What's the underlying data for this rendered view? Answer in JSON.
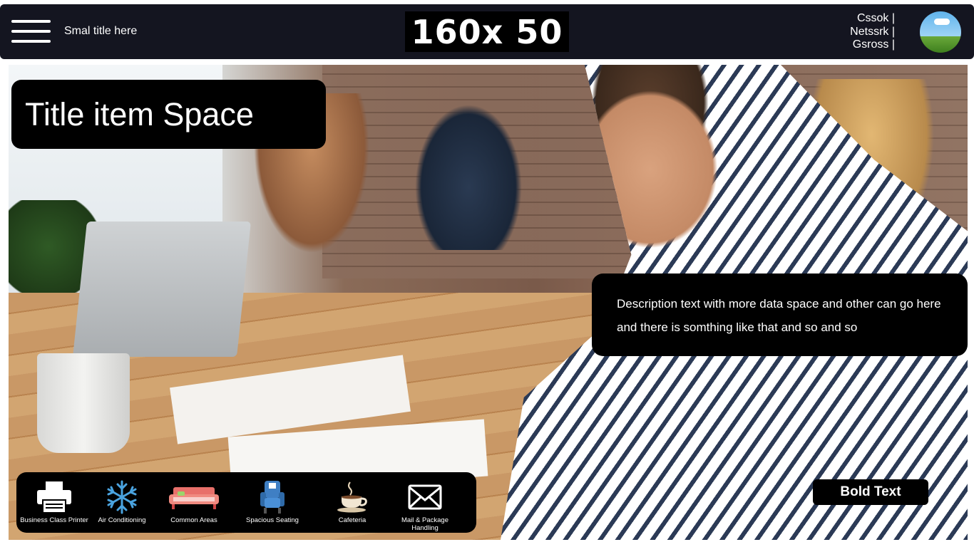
{
  "header": {
    "small_title": "Smal title  here",
    "logo_text": "160x 50",
    "user_links": [
      "Cssok |",
      "Netssrk |",
      "Gsross |"
    ]
  },
  "hero": {
    "title": "Title item Space",
    "description": "Description text with more data space and other can go here and there is somthing like that and so and so",
    "bold_button": "Bold Text"
  },
  "amenities": [
    {
      "label": "Business Class Printer",
      "icon": "printer-icon"
    },
    {
      "label": "Air Conditioning",
      "icon": "snowflake-icon"
    },
    {
      "label": "Common Areas",
      "icon": "sofa-icon"
    },
    {
      "label": "Spacious Seating",
      "icon": "chair-icon"
    },
    {
      "label": "Cafeteria",
      "icon": "coffee-cup-icon"
    },
    {
      "label": "Mail & Package Handling",
      "icon": "mail-envelope-icon"
    }
  ],
  "colors": {
    "header_bg": "#141520",
    "card_bg": "#000000",
    "snowflake": "#4aa3df",
    "sofa": "#e8706a",
    "chair": "#3f7fc4"
  }
}
